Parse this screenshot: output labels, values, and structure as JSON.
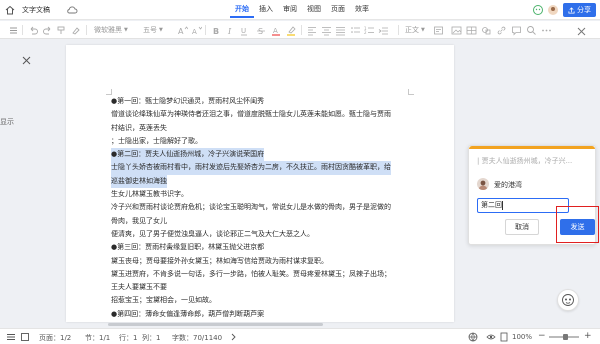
{
  "header": {
    "app_title": "文字文稿",
    "tabs": [
      {
        "label": "开始",
        "active": true
      },
      {
        "label": "插入"
      },
      {
        "label": "审阅"
      },
      {
        "label": "视图"
      },
      {
        "label": "页面"
      },
      {
        "label": "效率"
      }
    ],
    "share_label": "分享"
  },
  "toolbar": {
    "style_dropdown": "微软雅黑",
    "size_dropdown": "五号",
    "para_label": "正文"
  },
  "left_panel": {
    "label": "显示"
  },
  "document": {
    "lines": [
      "●第一回：甄士隐梦幻识通灵，贾雨村风尘怀闺秀",
      "僧道谈论绛珠仙草为神瑛侍者还泪之事，僧道度脱甄士隐女儿英莲未能如愿。甄士隐与贾雨",
      "村结识，英莲丢失",
      "；士隐出家，士隐解好了歌。",
      "●第二回：贾夫人仙逝扬州城，冷子兴演说荣国府",
      "士隐丫头娇杏被雨村看中，雨村发迹后先娶娇杏为二房，不久扶正。雨村因贪酷被革职，给",
      "巡盐御史林如海独",
      "生女儿林黛玉教书识字。",
      "冷子兴和贾雨村谈论贾府危机；谈论宝玉聪明淘气，常说女儿是水做的骨肉，男子是泥做的",
      "骨肉，我见了女儿",
      "便清爽，见了男子便觉浊臭逼人，谈论邪正二气及大仁大恶之人。",
      "●第三回：贾雨村夤缘复旧职，林黛玉抛父进京都",
      "黛玉丧母；贾母要接外孙女黛玉；林如海写信给贾政为雨村谋求复职。",
      "黛玉进贾府，不肯多说一句话，多行一步路，怕被人耻笑。贾母疼爱林黛玉；凤辣子出场；",
      "王夫人要黛玉不要",
      "招惹宝玉；宝黛相会，一见如故。",
      "●第四回：薄命女偏逢薄命郎，葫芦僧判断葫芦案"
    ],
    "highlighted_lines": [
      4,
      5,
      6
    ]
  },
  "comment": {
    "quote": "| 贾夫人仙逝扬州城，冷子兴...",
    "user": "爱的港湾",
    "input_value": "第二回",
    "cancel_label": "取消",
    "send_label": "发送"
  },
  "statusbar": {
    "page": "页面：1/2",
    "section": "节：1/1",
    "line": "行：1",
    "col": "列：1",
    "wordcount": "字数：70/1140",
    "zoom": "100%"
  },
  "colors": {
    "accent": "#2f6fea",
    "highlight": "#cfdff6",
    "comment_bar": "#f2a320",
    "annotation_box": "#e02020"
  }
}
